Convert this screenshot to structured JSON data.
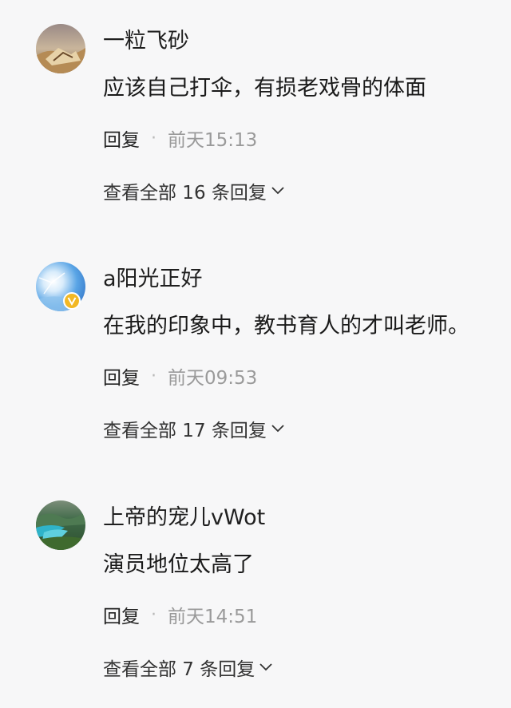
{
  "comments": [
    {
      "username": "一粒飞砂",
      "content": "应该自己打伞，有损老戏骨的体面",
      "reply_label": "回复",
      "separator": "·",
      "time": "前天15:13",
      "view_all": "查看全部 16 条回复",
      "avatar_icon": "desert-landscape-avatar",
      "verified": false
    },
    {
      "username": "a阳光正好",
      "content": "在我的印象中，教书育人的才叫老师。",
      "reply_label": "回复",
      "separator": "·",
      "time": "前天09:53",
      "view_all": "查看全部 17 条回复",
      "avatar_icon": "sunlight-sky-avatar",
      "verified": true
    },
    {
      "username": "上帝的宠儿vWot",
      "content": "演员地位太高了",
      "reply_label": "回复",
      "separator": "·",
      "time": "前天14:51",
      "view_all": "查看全部 7 条回复",
      "avatar_icon": "lake-mountain-avatar",
      "verified": false
    }
  ],
  "colors": {
    "background": "#f7f7f8",
    "text_primary": "#1a1a1a",
    "text_secondary": "#9a9a9a",
    "verified_badge": "#f2b824"
  }
}
